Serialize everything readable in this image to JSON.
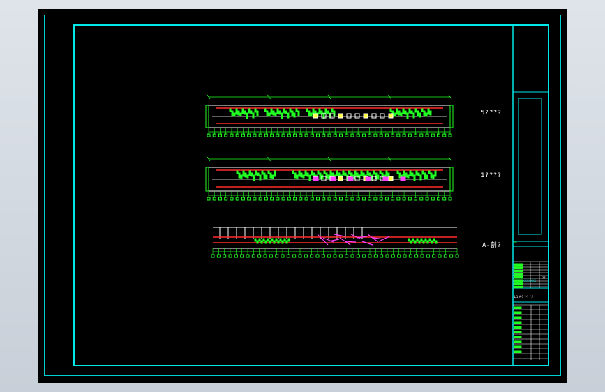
{
  "views": [
    {
      "label": "5????"
    },
    {
      "label": "1????"
    },
    {
      "label": "A-剖?"
    }
  ],
  "title_block": {
    "cell_1": "A-1",
    "stamp": "XXXXXXX",
    "note": "1/1 A-1 ?-? ?.?",
    "tag": "???"
  },
  "colors": {
    "background": "#000000",
    "frame": "#00e8e8",
    "track": "#ff2a2a",
    "outline": "#ffffff",
    "detail": "#22ff22",
    "accent": "#ff40ff",
    "highlight": "#ffff40"
  }
}
